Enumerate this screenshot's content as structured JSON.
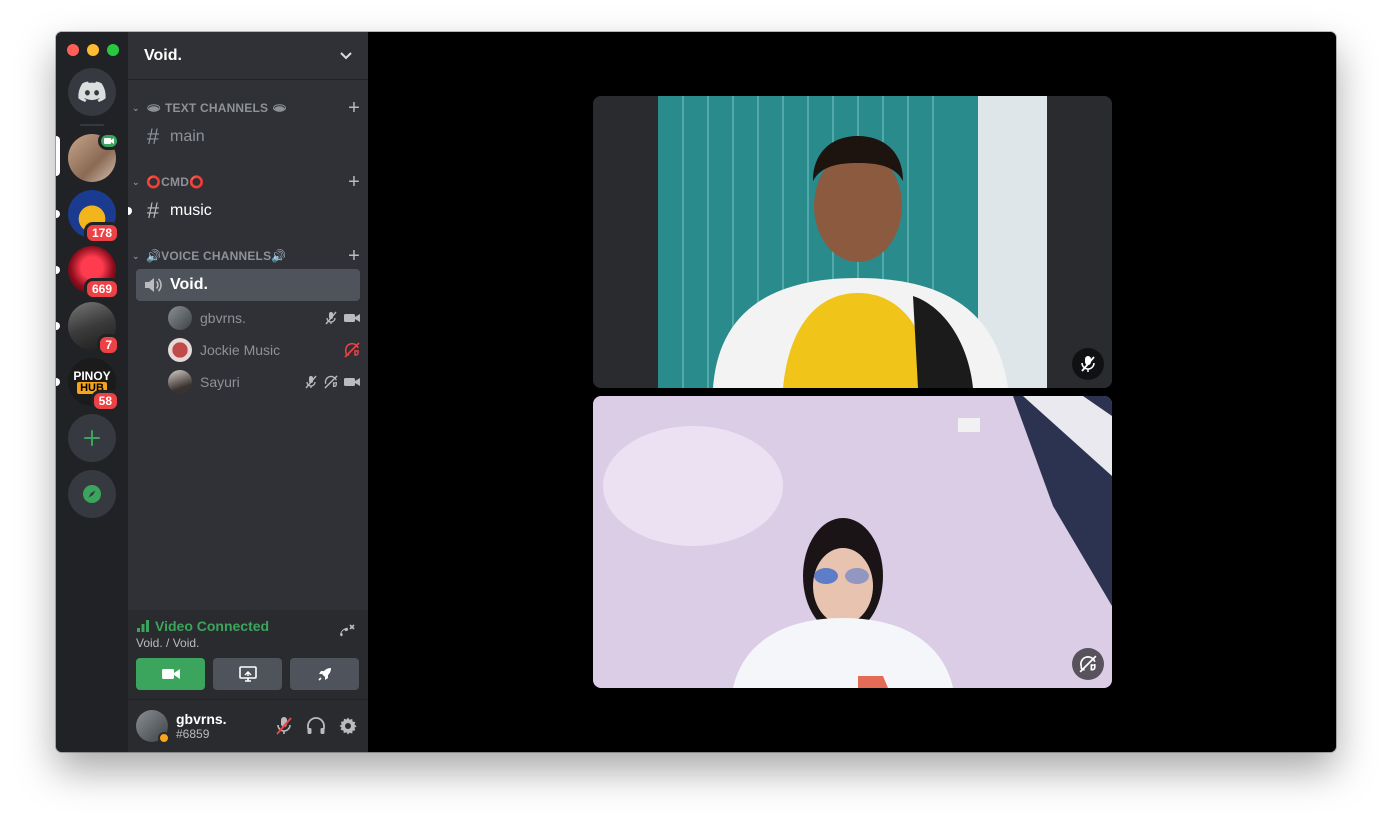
{
  "server": {
    "name": "Void.",
    "badges": [
      "178",
      "669",
      "7",
      "58"
    ],
    "pinoy_logo": [
      "PINOY",
      "HUB"
    ]
  },
  "categories": [
    {
      "label": "🕳 TEXT CHANNELS 🕳"
    },
    {
      "label": "⭕CMD⭕"
    },
    {
      "label": "🔊VOICE CHANNELS🔊"
    }
  ],
  "channels": {
    "main": "main",
    "music": "music",
    "voice": "Void."
  },
  "voice_users": [
    {
      "name": "gbvrns."
    },
    {
      "name": "Jockie Music"
    },
    {
      "name": "Sayuri"
    }
  ],
  "voice_panel": {
    "status": "Video Connected",
    "location": "Void. / Void."
  },
  "user": {
    "name": "gbvrns.",
    "tag": "#6859"
  },
  "colors": {
    "green": "#3ba55d",
    "red": "#ed4245",
    "rail": "#202225",
    "sidebar": "#2f3136"
  },
  "icons": {
    "home": "discord-logo-icon",
    "add_server": "plus-icon",
    "explore": "compass-icon"
  }
}
